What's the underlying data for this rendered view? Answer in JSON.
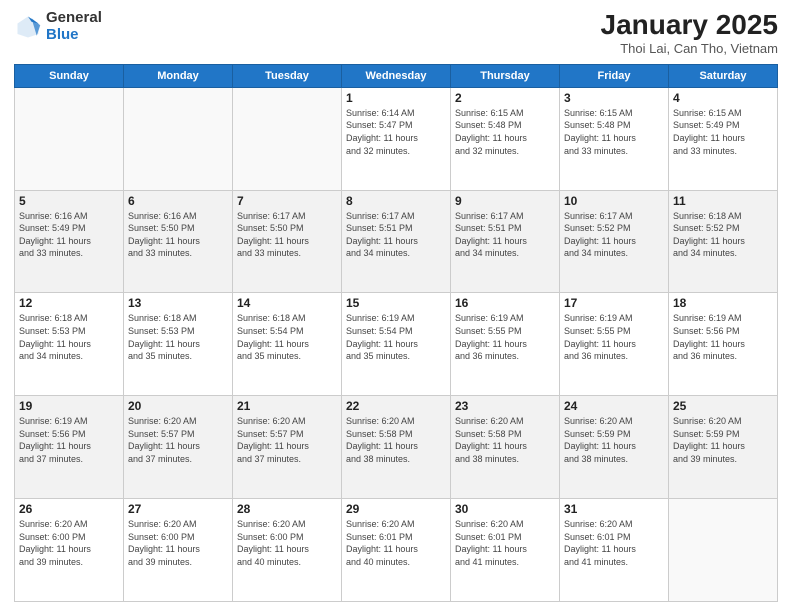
{
  "header": {
    "logo_general": "General",
    "logo_blue": "Blue",
    "title": "January 2025",
    "subtitle": "Thoi Lai, Can Tho, Vietnam"
  },
  "days_of_week": [
    "Sunday",
    "Monday",
    "Tuesday",
    "Wednesday",
    "Thursday",
    "Friday",
    "Saturday"
  ],
  "weeks": [
    [
      {
        "day": "",
        "info": ""
      },
      {
        "day": "",
        "info": ""
      },
      {
        "day": "",
        "info": ""
      },
      {
        "day": "1",
        "info": "Sunrise: 6:14 AM\nSunset: 5:47 PM\nDaylight: 11 hours\nand 32 minutes."
      },
      {
        "day": "2",
        "info": "Sunrise: 6:15 AM\nSunset: 5:48 PM\nDaylight: 11 hours\nand 32 minutes."
      },
      {
        "day": "3",
        "info": "Sunrise: 6:15 AM\nSunset: 5:48 PM\nDaylight: 11 hours\nand 33 minutes."
      },
      {
        "day": "4",
        "info": "Sunrise: 6:15 AM\nSunset: 5:49 PM\nDaylight: 11 hours\nand 33 minutes."
      }
    ],
    [
      {
        "day": "5",
        "info": "Sunrise: 6:16 AM\nSunset: 5:49 PM\nDaylight: 11 hours\nand 33 minutes."
      },
      {
        "day": "6",
        "info": "Sunrise: 6:16 AM\nSunset: 5:50 PM\nDaylight: 11 hours\nand 33 minutes."
      },
      {
        "day": "7",
        "info": "Sunrise: 6:17 AM\nSunset: 5:50 PM\nDaylight: 11 hours\nand 33 minutes."
      },
      {
        "day": "8",
        "info": "Sunrise: 6:17 AM\nSunset: 5:51 PM\nDaylight: 11 hours\nand 34 minutes."
      },
      {
        "day": "9",
        "info": "Sunrise: 6:17 AM\nSunset: 5:51 PM\nDaylight: 11 hours\nand 34 minutes."
      },
      {
        "day": "10",
        "info": "Sunrise: 6:17 AM\nSunset: 5:52 PM\nDaylight: 11 hours\nand 34 minutes."
      },
      {
        "day": "11",
        "info": "Sunrise: 6:18 AM\nSunset: 5:52 PM\nDaylight: 11 hours\nand 34 minutes."
      }
    ],
    [
      {
        "day": "12",
        "info": "Sunrise: 6:18 AM\nSunset: 5:53 PM\nDaylight: 11 hours\nand 34 minutes."
      },
      {
        "day": "13",
        "info": "Sunrise: 6:18 AM\nSunset: 5:53 PM\nDaylight: 11 hours\nand 35 minutes."
      },
      {
        "day": "14",
        "info": "Sunrise: 6:18 AM\nSunset: 5:54 PM\nDaylight: 11 hours\nand 35 minutes."
      },
      {
        "day": "15",
        "info": "Sunrise: 6:19 AM\nSunset: 5:54 PM\nDaylight: 11 hours\nand 35 minutes."
      },
      {
        "day": "16",
        "info": "Sunrise: 6:19 AM\nSunset: 5:55 PM\nDaylight: 11 hours\nand 36 minutes."
      },
      {
        "day": "17",
        "info": "Sunrise: 6:19 AM\nSunset: 5:55 PM\nDaylight: 11 hours\nand 36 minutes."
      },
      {
        "day": "18",
        "info": "Sunrise: 6:19 AM\nSunset: 5:56 PM\nDaylight: 11 hours\nand 36 minutes."
      }
    ],
    [
      {
        "day": "19",
        "info": "Sunrise: 6:19 AM\nSunset: 5:56 PM\nDaylight: 11 hours\nand 37 minutes."
      },
      {
        "day": "20",
        "info": "Sunrise: 6:20 AM\nSunset: 5:57 PM\nDaylight: 11 hours\nand 37 minutes."
      },
      {
        "day": "21",
        "info": "Sunrise: 6:20 AM\nSunset: 5:57 PM\nDaylight: 11 hours\nand 37 minutes."
      },
      {
        "day": "22",
        "info": "Sunrise: 6:20 AM\nSunset: 5:58 PM\nDaylight: 11 hours\nand 38 minutes."
      },
      {
        "day": "23",
        "info": "Sunrise: 6:20 AM\nSunset: 5:58 PM\nDaylight: 11 hours\nand 38 minutes."
      },
      {
        "day": "24",
        "info": "Sunrise: 6:20 AM\nSunset: 5:59 PM\nDaylight: 11 hours\nand 38 minutes."
      },
      {
        "day": "25",
        "info": "Sunrise: 6:20 AM\nSunset: 5:59 PM\nDaylight: 11 hours\nand 39 minutes."
      }
    ],
    [
      {
        "day": "26",
        "info": "Sunrise: 6:20 AM\nSunset: 6:00 PM\nDaylight: 11 hours\nand 39 minutes."
      },
      {
        "day": "27",
        "info": "Sunrise: 6:20 AM\nSunset: 6:00 PM\nDaylight: 11 hours\nand 39 minutes."
      },
      {
        "day": "28",
        "info": "Sunrise: 6:20 AM\nSunset: 6:00 PM\nDaylight: 11 hours\nand 40 minutes."
      },
      {
        "day": "29",
        "info": "Sunrise: 6:20 AM\nSunset: 6:01 PM\nDaylight: 11 hours\nand 40 minutes."
      },
      {
        "day": "30",
        "info": "Sunrise: 6:20 AM\nSunset: 6:01 PM\nDaylight: 11 hours\nand 41 minutes."
      },
      {
        "day": "31",
        "info": "Sunrise: 6:20 AM\nSunset: 6:01 PM\nDaylight: 11 hours\nand 41 minutes."
      },
      {
        "day": "",
        "info": ""
      }
    ]
  ]
}
